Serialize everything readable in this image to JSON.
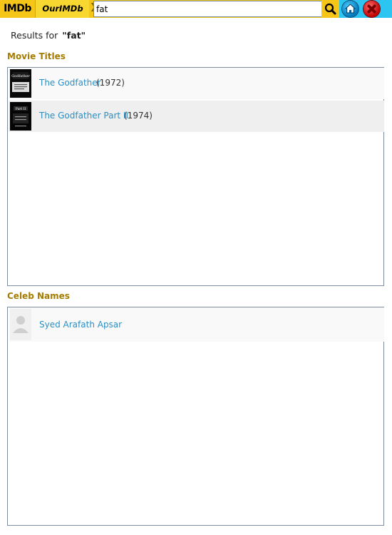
{
  "header": {
    "logo_imdb": "IMDb",
    "logo_our": "OurIMDb",
    "search": {
      "value": "fat",
      "placeholder": ""
    },
    "icons": {
      "search": "search-icon",
      "home": "home-icon",
      "close": "close-icon"
    }
  },
  "results": {
    "prefix": "Results for",
    "query": "\"fat\""
  },
  "movies": {
    "title": "Movie Titles",
    "items": [
      {
        "title": "The Godfather",
        "year": "(1972)"
      },
      {
        "title": "The Godfather Part II",
        "year": "(1974)"
      }
    ]
  },
  "celebs": {
    "title": "Celeb Names",
    "items": [
      {
        "name": "Syed Arafath Apsar"
      }
    ]
  },
  "colors": {
    "accent": "#f5c518",
    "section_title": "#a57c00",
    "link": "#2a8fc4",
    "header_blue": "#2cc5f2"
  }
}
